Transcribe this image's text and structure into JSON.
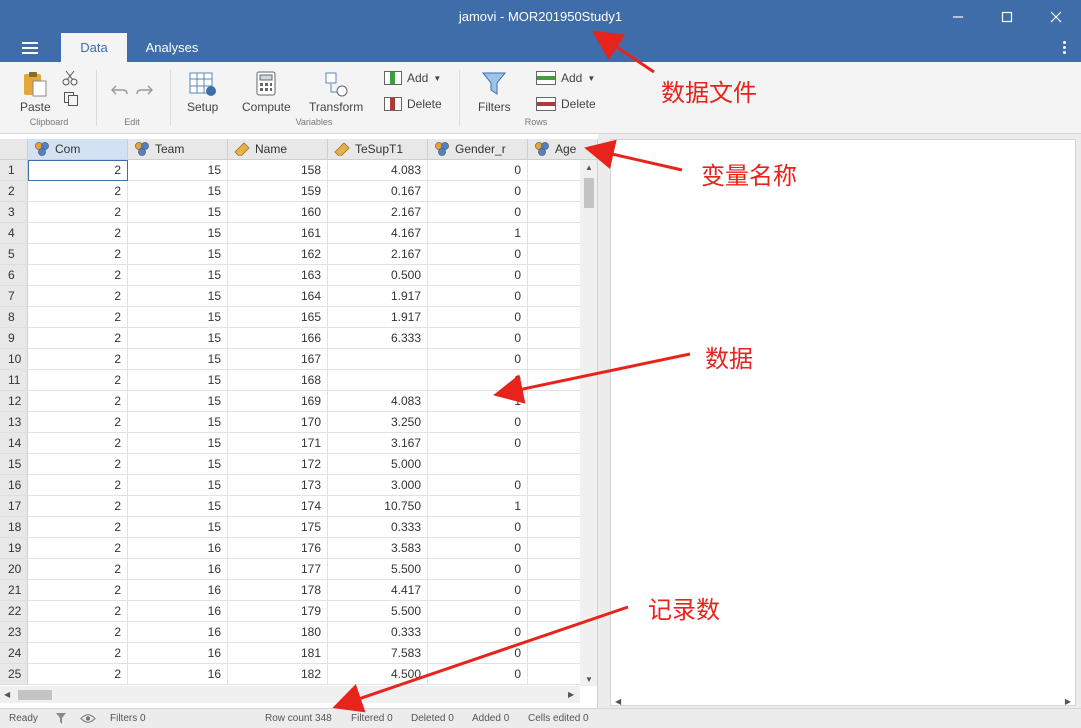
{
  "window": {
    "title": "jamovi - MOR201950Study1"
  },
  "tabs": [
    {
      "label": "Data",
      "active": true
    },
    {
      "label": "Analyses",
      "active": false
    }
  ],
  "ribbon": {
    "paste_label": "Paste",
    "clipboard_group": "Clipboard",
    "edit_group": "Edit",
    "setup_label": "Setup",
    "compute_label": "Compute",
    "transform_label": "Transform",
    "var_add_label": "Add",
    "var_delete_label": "Delete",
    "variables_group": "Variables",
    "filters_label": "Filters",
    "row_add_label": "Add",
    "row_delete_label": "Delete",
    "rows_group": "Rows"
  },
  "columns": [
    {
      "name": "Com",
      "type": "nominal"
    },
    {
      "name": "Team",
      "type": "nominal"
    },
    {
      "name": "Name",
      "type": "id"
    },
    {
      "name": "TeSupT1",
      "type": "continuous"
    },
    {
      "name": "Gender_r",
      "type": "nominal"
    },
    {
      "name": "Age",
      "type": "nominal"
    }
  ],
  "rows": [
    [
      "1",
      "2",
      "15",
      "158",
      "4.083",
      "0",
      ""
    ],
    [
      "2",
      "2",
      "15",
      "159",
      "0.167",
      "0",
      ""
    ],
    [
      "3",
      "2",
      "15",
      "160",
      "2.167",
      "0",
      ""
    ],
    [
      "4",
      "2",
      "15",
      "161",
      "4.167",
      "1",
      ""
    ],
    [
      "5",
      "2",
      "15",
      "162",
      "2.167",
      "0",
      ""
    ],
    [
      "6",
      "2",
      "15",
      "163",
      "0.500",
      "0",
      ""
    ],
    [
      "7",
      "2",
      "15",
      "164",
      "1.917",
      "0",
      ""
    ],
    [
      "8",
      "2",
      "15",
      "165",
      "1.917",
      "0",
      ""
    ],
    [
      "9",
      "2",
      "15",
      "166",
      "6.333",
      "0",
      ""
    ],
    [
      "10",
      "2",
      "15",
      "167",
      "",
      "0",
      ""
    ],
    [
      "11",
      "2",
      "15",
      "168",
      "",
      "0",
      ""
    ],
    [
      "12",
      "2",
      "15",
      "169",
      "4.083",
      "1",
      ""
    ],
    [
      "13",
      "2",
      "15",
      "170",
      "3.250",
      "0",
      ""
    ],
    [
      "14",
      "2",
      "15",
      "171",
      "3.167",
      "0",
      ""
    ],
    [
      "15",
      "2",
      "15",
      "172",
      "5.000",
      "",
      ""
    ],
    [
      "16",
      "2",
      "15",
      "173",
      "3.000",
      "0",
      ""
    ],
    [
      "17",
      "2",
      "15",
      "174",
      "10.750",
      "1",
      ""
    ],
    [
      "18",
      "2",
      "15",
      "175",
      "0.333",
      "0",
      ""
    ],
    [
      "19",
      "2",
      "16",
      "176",
      "3.583",
      "0",
      ""
    ],
    [
      "20",
      "2",
      "16",
      "177",
      "5.500",
      "0",
      ""
    ],
    [
      "21",
      "2",
      "16",
      "178",
      "4.417",
      "0",
      ""
    ],
    [
      "22",
      "2",
      "16",
      "179",
      "5.500",
      "0",
      ""
    ],
    [
      "23",
      "2",
      "16",
      "180",
      "0.333",
      "0",
      ""
    ],
    [
      "24",
      "2",
      "16",
      "181",
      "7.583",
      "0",
      ""
    ],
    [
      "25",
      "2",
      "16",
      "182",
      "4.500",
      "0",
      ""
    ]
  ],
  "status": {
    "ready": "Ready",
    "filters": "Filters 0",
    "row_count": "Row count 348",
    "filtered": "Filtered 0",
    "deleted": "Deleted 0",
    "added": "Added 0",
    "cells_edited": "Cells edited 0"
  },
  "annotations": {
    "data_file": "数据文件",
    "variable_name": "变量名称",
    "data": "数据",
    "record_count": "记录数"
  },
  "colors": {
    "titlebar": "#3e6da9",
    "annotation": "#e8231c"
  }
}
